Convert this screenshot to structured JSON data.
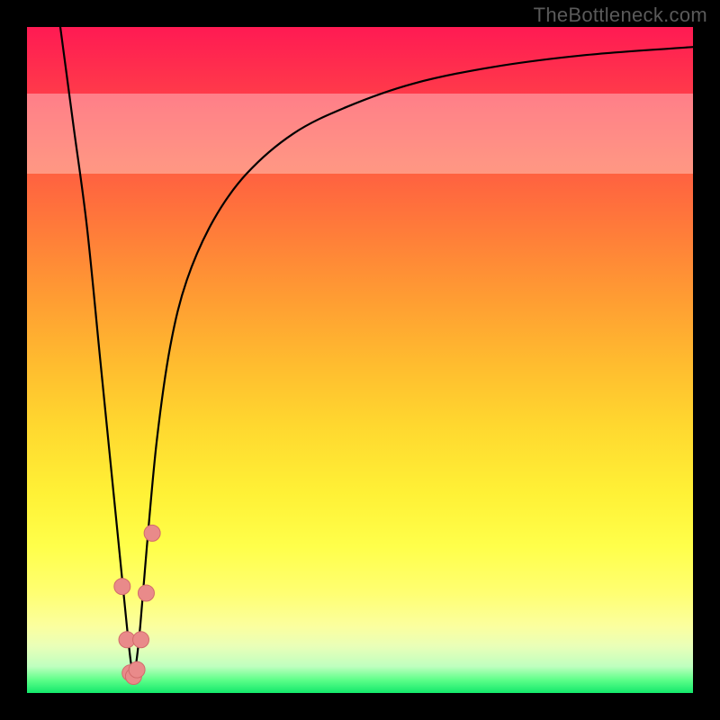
{
  "watermark": "TheBottleneck.com",
  "colors": {
    "frame": "#000000",
    "curve_stroke": "#000000",
    "marker_fill": "#e98a8a",
    "marker_stroke": "#d26b6b"
  },
  "chart_data": {
    "type": "line",
    "title": "",
    "xlabel": "",
    "ylabel": "",
    "xlim": [
      0,
      100
    ],
    "ylim": [
      0,
      100
    ],
    "grid": false,
    "legend": false,
    "series": [
      {
        "name": "bottleneck-v-curve",
        "x": [
          5,
          7,
          9,
          11,
          12.5,
          14,
          15,
          15.7,
          16.3,
          17,
          18,
          19.5,
          21.5,
          24,
          28,
          33,
          40,
          48,
          58,
          70,
          84,
          100
        ],
        "y": [
          100,
          85,
          70,
          50,
          35,
          20,
          10,
          4,
          4,
          10,
          22,
          38,
          52,
          62,
          71,
          78,
          84,
          88,
          91.5,
          94,
          95.8,
          97
        ]
      }
    ],
    "markers": {
      "name": "highlight-points",
      "x": [
        14.3,
        15.0,
        15.5,
        16.0,
        16.5,
        17.1,
        17.9,
        18.8
      ],
      "y": [
        16,
        8,
        3,
        2.5,
        3.5,
        8,
        15,
        24
      ]
    },
    "light_band_y_range": [
      78,
      90
    ]
  }
}
